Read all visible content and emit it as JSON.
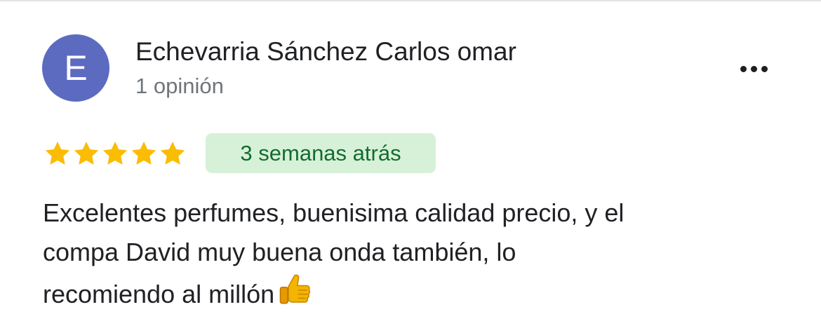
{
  "author": {
    "avatar_letter": "E",
    "avatar_color": "#5c6bc0",
    "name": "Echevarria Sánchez Carlos omar",
    "review_count": "1 opinión"
  },
  "menu": {
    "icon": "more-horizontal-icon"
  },
  "review": {
    "rating": 5,
    "max_rating": 5,
    "star_color": "#fbbc04",
    "time_ago": "3 semanas atrás",
    "badge_color": "#d7f1d9",
    "badge_text_color": "#146c2e",
    "text_lines": [
      "Excelentes perfumes, buenisima calidad precio, y el",
      "compa David muy buena onda también, lo",
      "recomiendo al millón"
    ],
    "emoji": "thumbs-up-emoji"
  }
}
